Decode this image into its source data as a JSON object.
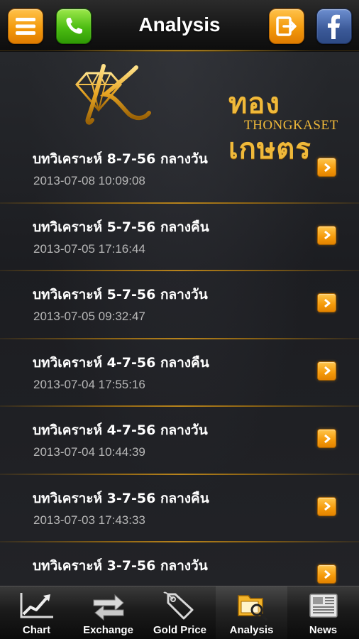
{
  "header": {
    "title": "Analysis",
    "icons": [
      "menu-icon",
      "phone-icon",
      "logout-icon",
      "facebook-icon"
    ]
  },
  "logo": {
    "thai": "ทองเกษตร",
    "english": "THONGKASET"
  },
  "items": [
    {
      "title": "บทวิเคราะห์ 8-7-56 กลางวัน",
      "date": "2013-07-08 10:09:08"
    },
    {
      "title": "บทวิเคราะห์ 5-7-56 กลางคืน",
      "date": "2013-07-05 17:16:44"
    },
    {
      "title": "บทวิเคราะห์ 5-7-56 กลางวัน",
      "date": "2013-07-05 09:32:47"
    },
    {
      "title": "บทวิเคราะห์ 4-7-56 กลางคืน",
      "date": "2013-07-04 17:55:16"
    },
    {
      "title": "บทวิเคราะห์ 4-7-56 กลางวัน",
      "date": "2013-07-04 10:44:39"
    },
    {
      "title": "บทวิเคราะห์ 3-7-56 กลางคืน",
      "date": "2013-07-03 17:43:33"
    },
    {
      "title": "บทวิเคราะห์ 3-7-56 กลางวัน",
      "date": ""
    }
  ],
  "tabs": [
    {
      "label": "Chart",
      "icon": "chart-icon"
    },
    {
      "label": "Exchange",
      "icon": "exchange-icon"
    },
    {
      "label": "Gold Price",
      "icon": "price-tag-icon"
    },
    {
      "label": "Analysis",
      "icon": "analysis-icon",
      "active": true
    },
    {
      "label": "News",
      "icon": "news-icon"
    }
  ],
  "colors": {
    "accent_orange": "#f39a0c",
    "gold": "#f0b93a",
    "phone_green": "#4cbc12",
    "facebook_blue": "#3b5998"
  }
}
